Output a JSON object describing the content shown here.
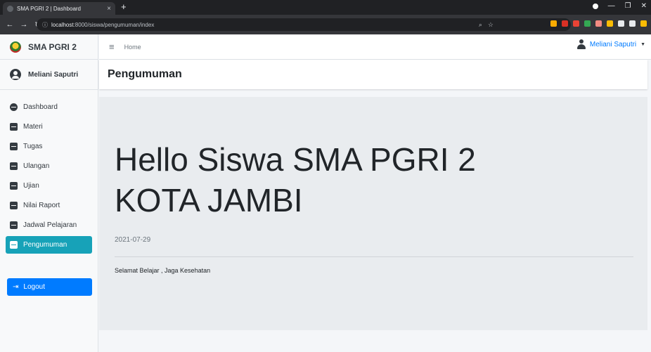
{
  "browser": {
    "tab_title": "SMA PGRI 2 | Dashboard",
    "tab_close": "×",
    "new_tab": "+",
    "url_host": "localhost",
    "url_path": ":8000/siswa/pengumuman/index",
    "extension_colors": [
      "#f9ab00",
      "#d93025",
      "#ea4335",
      "#34a853",
      "#f28b82",
      "#fbbc04",
      "#e8eaed",
      "#e8eaed",
      "#fbbc04"
    ]
  },
  "brand": {
    "name": "SMA PGRI 2"
  },
  "user": {
    "name": "Meliani Saputri"
  },
  "menu": {
    "items": [
      {
        "label": "Dashboard",
        "icon": "dashboard-icon"
      },
      {
        "label": "Materi",
        "icon": "book-icon"
      },
      {
        "label": "Tugas",
        "icon": "book-icon"
      },
      {
        "label": "Ulangan",
        "icon": "book-icon"
      },
      {
        "label": "Ujian",
        "icon": "book-icon"
      },
      {
        "label": "Nilai Raport",
        "icon": "book-icon"
      },
      {
        "label": "Jadwal Pelajaran",
        "icon": "book-icon"
      },
      {
        "label": "Pengumuman",
        "icon": "book-icon",
        "active": true
      }
    ],
    "logout": "Logout"
  },
  "topnav": {
    "home": "Home",
    "user": "Meliani Saputri"
  },
  "page": {
    "title": "Pengumuman"
  },
  "announcement": {
    "heading": "Hello Siswa SMA PGRI 2 KOTA JAMBI",
    "date": "2021-07-29",
    "message": "Selamat Belajar , Jaga Kesehatan"
  },
  "colors": {
    "active": "#17a2b8",
    "primary": "#007bff",
    "jumbotron": "#e9ecef"
  }
}
